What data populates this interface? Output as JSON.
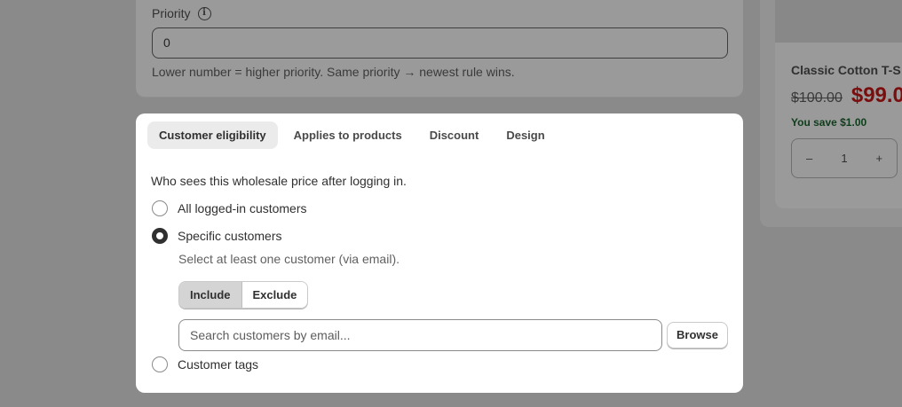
{
  "background": {
    "priority": {
      "label": "Priority",
      "info_glyph": "i",
      "value": "0",
      "help": "Lower number = higher priority. Same priority → newest rule wins."
    },
    "preview": {
      "product_title": "Classic Cotton T-S",
      "price_old": "$100.00",
      "price_new": "$99.0",
      "savings": "You save $1.00",
      "qty_minus": "–",
      "qty_value": "1",
      "qty_plus": "+"
    }
  },
  "modal": {
    "tabs": [
      {
        "label": "Customer eligibility",
        "active": true
      },
      {
        "label": "Applies to products",
        "active": false
      },
      {
        "label": "Discount",
        "active": false
      },
      {
        "label": "Design",
        "active": false
      }
    ],
    "description": "Who sees this wholesale price after logging in.",
    "options": [
      {
        "label": "All logged-in customers",
        "checked": false
      },
      {
        "label": "Specific customers",
        "checked": true
      },
      {
        "label": "Customer tags",
        "checked": false
      }
    ],
    "specific_help": "Select at least one customer (via email).",
    "mode_toggle": {
      "include": "Include",
      "exclude": "Exclude",
      "selected": "Include"
    },
    "search_placeholder": "Search customers by email...",
    "browse_label": "Browse"
  },
  "colors": {
    "overlay_bg": "#8a8a8a",
    "price_sale": "#7a0e0e",
    "savings": "#0e3d1b",
    "active_tab": "#ebebeb"
  }
}
